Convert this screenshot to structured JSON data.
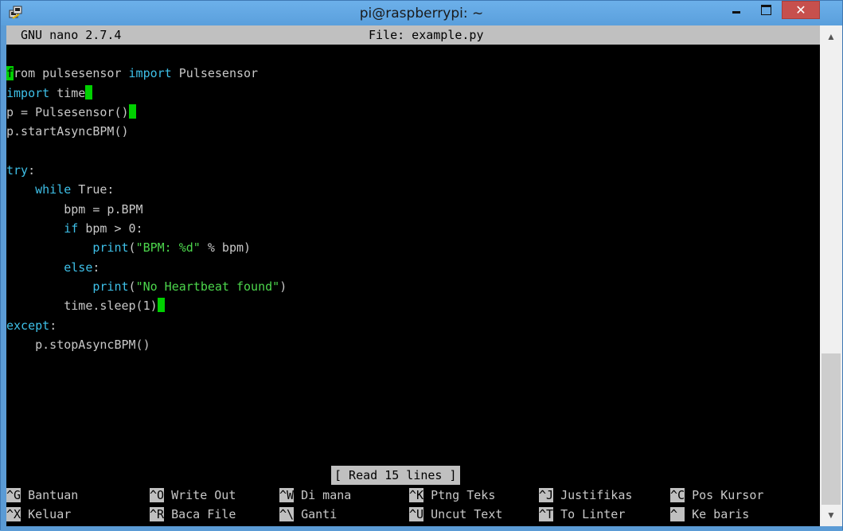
{
  "window": {
    "title": "pi@raspberrypi: ~",
    "close_glyph": "✕",
    "icons": [
      "putty-icon",
      "minimize-icon",
      "maximize-icon",
      "close-icon"
    ]
  },
  "nano": {
    "version": "GNU nano 2.7.4",
    "file": "File: example.py",
    "status": "[ Read 15 lines ]"
  },
  "code": {
    "l1_rest": "rom pulsesensor ",
    "l1_first": "f",
    "l1_import": "import",
    "l1_tail": " Pulsesensor",
    "l2_kw": "import",
    "l2_rest": " time",
    "l3": "p = Pulsesensor()",
    "l4": "p.startAsyncBPM()",
    "l6_kw": "try",
    "l6_rest": ":",
    "l7_indent": "    ",
    "l7_kw": "while",
    "l7_rest": " True:",
    "l8": "        bpm = p.BPM",
    "l9_indent": "        ",
    "l9_kw": "if",
    "l9_rest": " bpm > 0:",
    "l10_indent": "            ",
    "l10_kw": "print",
    "l10_paren": "(",
    "l10_str": "\"BPM: %d\"",
    "l10_rest": " % bpm)",
    "l11_indent": "        ",
    "l11_kw": "else",
    "l11_rest": ":",
    "l12_indent": "            ",
    "l12_kw": "print",
    "l12_paren": "(",
    "l12_str": "\"No Heartbeat found\"",
    "l12_rest": ")",
    "l13": "        time.sleep(1)",
    "l14_kw": "except",
    "l14_rest": ":",
    "l15": "    p.stopAsyncBPM()"
  },
  "shortcuts": {
    "row1": [
      {
        "key": "^G",
        "label": " Bantuan"
      },
      {
        "key": "^O",
        "label": " Write Out"
      },
      {
        "key": "^W",
        "label": " Di mana"
      },
      {
        "key": "^K",
        "label": " Ptng Teks"
      },
      {
        "key": "^J",
        "label": " Justifikas"
      },
      {
        "key": "^C",
        "label": " Pos Kursor"
      }
    ],
    "row2": [
      {
        "key": "^X",
        "label": " Keluar"
      },
      {
        "key": "^R",
        "label": " Baca File"
      },
      {
        "key": "^\\",
        "label": " Ganti"
      },
      {
        "key": "^U",
        "label": " Uncut Text"
      },
      {
        "key": "^T",
        "label": " To Linter"
      },
      {
        "key": "^ ",
        "label": " Ke baris"
      }
    ]
  },
  "scrollbar": {
    "up_glyph": "▲",
    "down_glyph": "▼"
  },
  "colors": {
    "titlebar": "#5b9bd5",
    "keyword": "#3ec0e8",
    "string": "#4cd64c",
    "cursor": "#00d000",
    "close": "#c7504d"
  }
}
